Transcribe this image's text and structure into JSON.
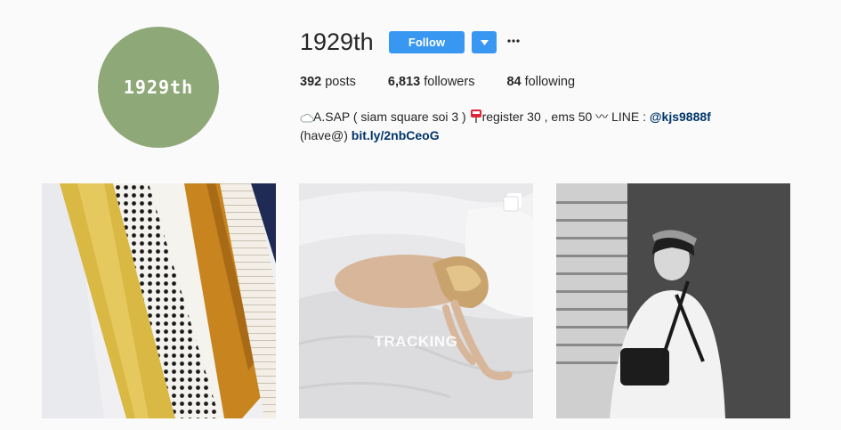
{
  "profile": {
    "avatar_text": "1929th",
    "avatar_color": "#8fa878",
    "username": "1929th",
    "follow_label": "Follow",
    "more_icon": "more-dots-icon",
    "dropdown_icon": "chevron-down-icon"
  },
  "stats": {
    "posts_count": "392",
    "posts_label": "posts",
    "followers_count": "6,813",
    "followers_label": "followers",
    "following_count": "84",
    "following_label": "following"
  },
  "bio": {
    "line1_text": "A.SAP ( siam square soi 3 ) ",
    "line1_text2": "register 30 , ems 50 〰 LINE : ",
    "line1_link": "@kjs9888f",
    "line2_text": "(have@) ",
    "line2_link": "bit.ly/2nbCeoG",
    "icons": [
      "cloud-icon",
      "mailbox-icon"
    ]
  },
  "posts": [
    {
      "subject": "folded fabrics",
      "multi": false
    },
    {
      "subject": "woman lying on bed",
      "multi": true,
      "overlay_text": "TRACKING"
    },
    {
      "subject": "girl with bag black and white",
      "multi": false
    }
  ],
  "colors": {
    "accent": "#3897f0",
    "link": "#003569",
    "background": "#fafafa"
  }
}
